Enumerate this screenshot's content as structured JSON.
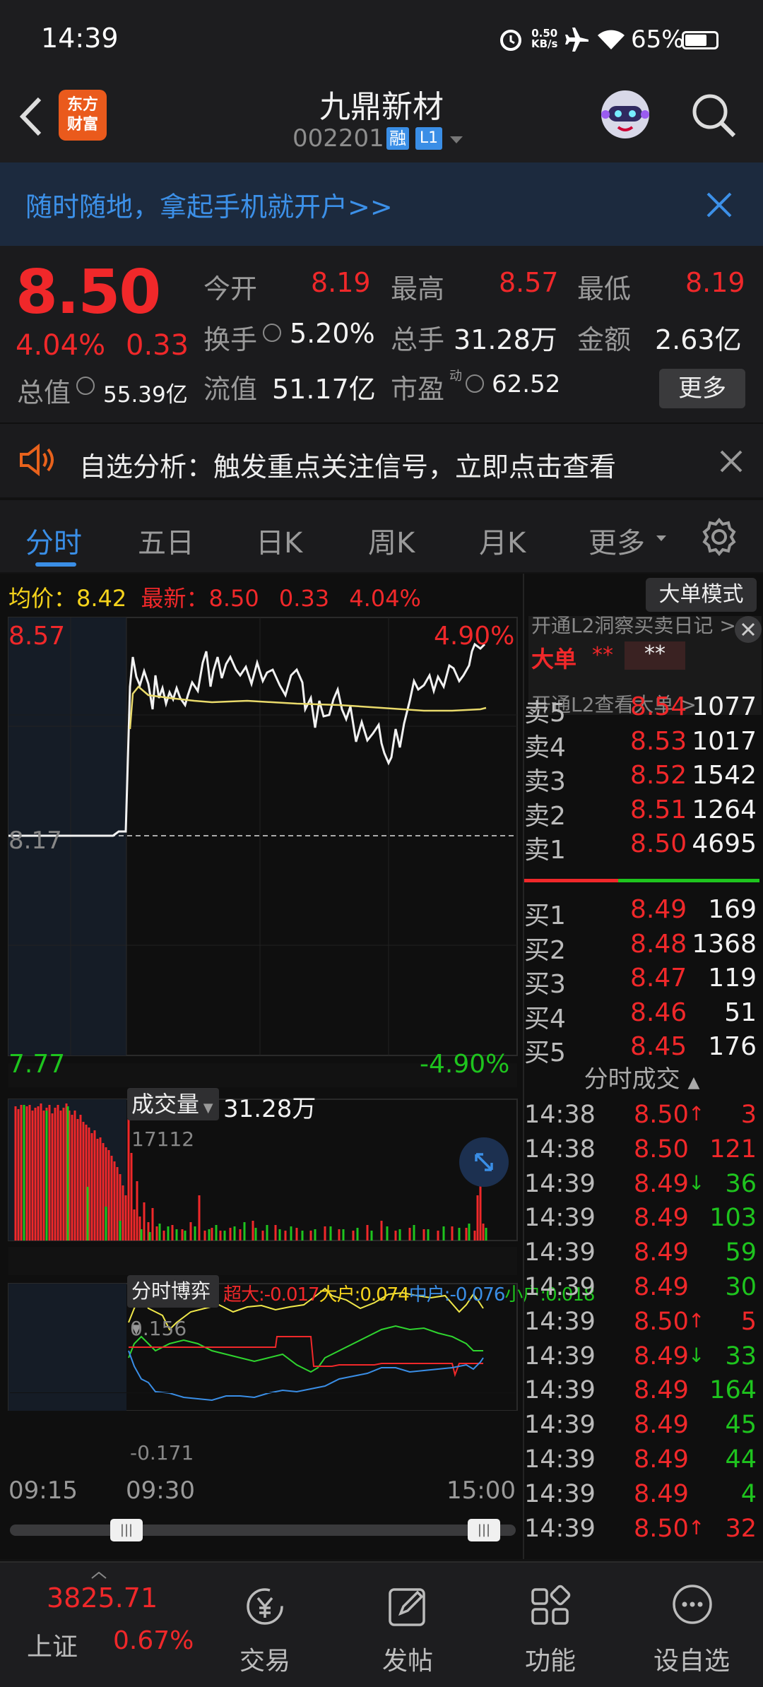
{
  "status_bar": {
    "time": "14:39",
    "net_speed_top": "0.50",
    "net_speed_bottom": "KB/s",
    "battery": "65%"
  },
  "header": {
    "logo_line1": "东方",
    "logo_line2": "财富",
    "stock_name": "九鼎新材",
    "stock_code": "002201",
    "badge_rong": "融",
    "badge_level": "L1"
  },
  "banner": {
    "text": "随时随地，拿起手机就开户>>"
  },
  "quote": {
    "price": "8.50",
    "change_pct": "4.04%",
    "change": "0.33",
    "open_label": "今开",
    "open": "8.19",
    "high_label": "最高",
    "high": "8.57",
    "low_label": "最低",
    "low": "8.19",
    "turnover_label": "换手",
    "turnover": "5.20%",
    "volume_label": "总手",
    "volume": "31.28万",
    "amount_label": "金额",
    "amount": "2.63亿",
    "mktcap_label": "总值",
    "mktcap": "55.39亿",
    "float_label": "流值",
    "float": "51.17亿",
    "pe_label": "市盈",
    "pe_sup": "动",
    "pe": "62.52",
    "more_btn": "更多"
  },
  "notice": {
    "text": "自选分析：触发重点关注信号，立即点击查看"
  },
  "tabs": [
    "分时",
    "五日",
    "日K",
    "周K",
    "月K",
    "更多"
  ],
  "info_line": {
    "avg_label": "均价：",
    "avg": "8.42",
    "latest_label": "最新：",
    "latest": "8.50",
    "change": "0.33",
    "pct": "4.04%",
    "mode_btn": "大单模式"
  },
  "chart_labels": {
    "top_price": "8.57",
    "top_pct": "4.90%",
    "mid_price": "8.17",
    "bottom_price": "7.77",
    "bottom_pct": "-4.90%"
  },
  "volume_panel": {
    "label": "成交量",
    "total": "31.28万",
    "max": "17112"
  },
  "game_panel": {
    "label": "分时博弈",
    "super_large": "超大:-0.017",
    "large": "大户:0.074",
    "mid": "中户:-0.076",
    "small": "小户:0.018",
    "max": "0.156",
    "min": "-0.171"
  },
  "time_axis": [
    "09:15",
    "09:30",
    "15:00"
  ],
  "l2_tip": {
    "line1": "开通L2洞察买卖日记 >",
    "big_order": "大单",
    "stars1": "**",
    "stars2": "**",
    "line3": "开通L2查看大单 >"
  },
  "order_book": {
    "asks": [
      {
        "label": "卖5",
        "price": "8.54",
        "vol": "1077"
      },
      {
        "label": "卖4",
        "price": "8.53",
        "vol": "1017"
      },
      {
        "label": "卖3",
        "price": "8.52",
        "vol": "1542"
      },
      {
        "label": "卖2",
        "price": "8.51",
        "vol": "1264"
      },
      {
        "label": "卖1",
        "price": "8.50",
        "vol": "4695"
      }
    ],
    "bids": [
      {
        "label": "买1",
        "price": "8.49",
        "vol": "169"
      },
      {
        "label": "买2",
        "price": "8.48",
        "vol": "1368"
      },
      {
        "label": "买3",
        "price": "8.47",
        "vol": "119"
      },
      {
        "label": "买4",
        "price": "8.46",
        "vol": "51"
      },
      {
        "label": "买5",
        "price": "8.45",
        "vol": "176"
      }
    ]
  },
  "trades_header": "分时成交",
  "trades": [
    {
      "time": "14:38",
      "price": "8.50",
      "arrow": "↑",
      "vol": "3",
      "dir": "up"
    },
    {
      "time": "14:38",
      "price": "8.50",
      "arrow": "",
      "vol": "121",
      "dir": "up"
    },
    {
      "time": "14:39",
      "price": "8.49",
      "arrow": "↓",
      "vol": "36",
      "dir": "down"
    },
    {
      "time": "14:39",
      "price": "8.49",
      "arrow": "",
      "vol": "103",
      "dir": "down"
    },
    {
      "time": "14:39",
      "price": "8.49",
      "arrow": "",
      "vol": "59",
      "dir": "down"
    },
    {
      "time": "14:39",
      "price": "8.49",
      "arrow": "",
      "vol": "30",
      "dir": "down"
    },
    {
      "time": "14:39",
      "price": "8.50",
      "arrow": "↑",
      "vol": "5",
      "dir": "up"
    },
    {
      "time": "14:39",
      "price": "8.49",
      "arrow": "↓",
      "vol": "33",
      "dir": "down"
    },
    {
      "time": "14:39",
      "price": "8.49",
      "arrow": "",
      "vol": "164",
      "dir": "down"
    },
    {
      "time": "14:39",
      "price": "8.49",
      "arrow": "",
      "vol": "45",
      "dir": "down"
    },
    {
      "time": "14:39",
      "price": "8.49",
      "arrow": "",
      "vol": "44",
      "dir": "down"
    },
    {
      "time": "14:39",
      "price": "8.49",
      "arrow": "",
      "vol": "4",
      "dir": "down"
    },
    {
      "time": "14:39",
      "price": "8.50",
      "arrow": "↑",
      "vol": "32",
      "dir": "up"
    }
  ],
  "bottom_nav": {
    "index_value": "3825.71",
    "index_name": "上证",
    "index_pct": "0.67%",
    "items": [
      {
        "label": "交易"
      },
      {
        "label": "发帖"
      },
      {
        "label": "功能"
      },
      {
        "label": "设自选"
      }
    ]
  },
  "colors": {
    "up": "#f0282a",
    "down": "#1ec41e",
    "accent": "#3a8ee6",
    "avg_line": "#f5d31c"
  }
}
